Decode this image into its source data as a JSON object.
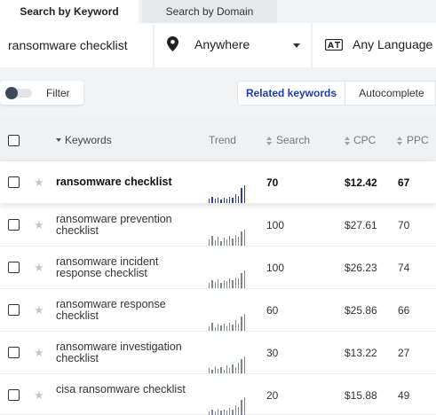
{
  "tabs": {
    "active": "Search by Keyword",
    "inactive": "Search by Domain"
  },
  "search": {
    "value": "ransomware checklist",
    "placeholder": "",
    "location": "Anywhere",
    "language": "Any Language"
  },
  "filter": {
    "label": "Filter",
    "enabled": false
  },
  "modes": {
    "active": "Related keywords",
    "inactive": "Autocomplete"
  },
  "table": {
    "columns": {
      "keywords": "Keywords",
      "trend": "Trend",
      "search": "Search",
      "cpc": "CPC",
      "ppc": "PPC"
    },
    "rows": [
      {
        "keyword": "ransomware checklist",
        "search": "70",
        "cpc": "$12.42",
        "ppc": "67",
        "highlight": true,
        "trend": [
          0.25,
          0.35,
          0.25,
          0.3,
          0.2,
          0.3,
          0.25,
          0.35,
          0.3,
          0.5,
          0.4,
          0.85,
          1
        ]
      },
      {
        "keyword": "ransomware prevention checklist",
        "search": "100",
        "cpc": "$27.61",
        "ppc": "70",
        "highlight": false,
        "trend": [
          0.35,
          0.55,
          0.3,
          0.5,
          0.25,
          0.45,
          0.35,
          0.55,
          0.4,
          0.6,
          0.5,
          0.8,
          0.9
        ]
      },
      {
        "keyword": "ransomware incident response checklist",
        "search": "100",
        "cpc": "$26.23",
        "ppc": "74",
        "highlight": false,
        "trend": [
          0.3,
          0.45,
          0.35,
          0.5,
          0.3,
          0.45,
          0.4,
          0.55,
          0.45,
          0.6,
          0.55,
          0.85,
          1
        ]
      },
      {
        "keyword": "ransomware response checklist",
        "search": "60",
        "cpc": "$25.86",
        "ppc": "66",
        "highlight": false,
        "trend": [
          0.25,
          0.45,
          0.2,
          0.4,
          0.3,
          0.4,
          0.25,
          0.45,
          0.35,
          0.6,
          0.4,
          0.8,
          0.95
        ]
      },
      {
        "keyword": "ransomware investigation checklist",
        "search": "30",
        "cpc": "$13.22",
        "ppc": "27",
        "highlight": false,
        "trend": [
          0.3,
          0.2,
          0.4,
          0.25,
          0.35,
          0.2,
          0.45,
          0.3,
          0.5,
          0.35,
          0.6,
          0.8,
          0.95
        ]
      },
      {
        "keyword": "cisa ransomware checklist",
        "search": "20",
        "cpc": "$15.88",
        "ppc": "49",
        "highlight": false,
        "trend": [
          0.2,
          0.3,
          0.2,
          0.35,
          0.25,
          0.3,
          0.25,
          0.4,
          0.3,
          0.55,
          0.45,
          0.85,
          1
        ]
      }
    ]
  },
  "colors": {
    "accent": "#1d3ea8",
    "trend_highlight": "#2f3f9f",
    "trend": "#7d8692"
  },
  "icons": {
    "location": "map-pin-icon",
    "language": "translate-icon",
    "sort": "sort-icon",
    "star": "star-icon"
  }
}
